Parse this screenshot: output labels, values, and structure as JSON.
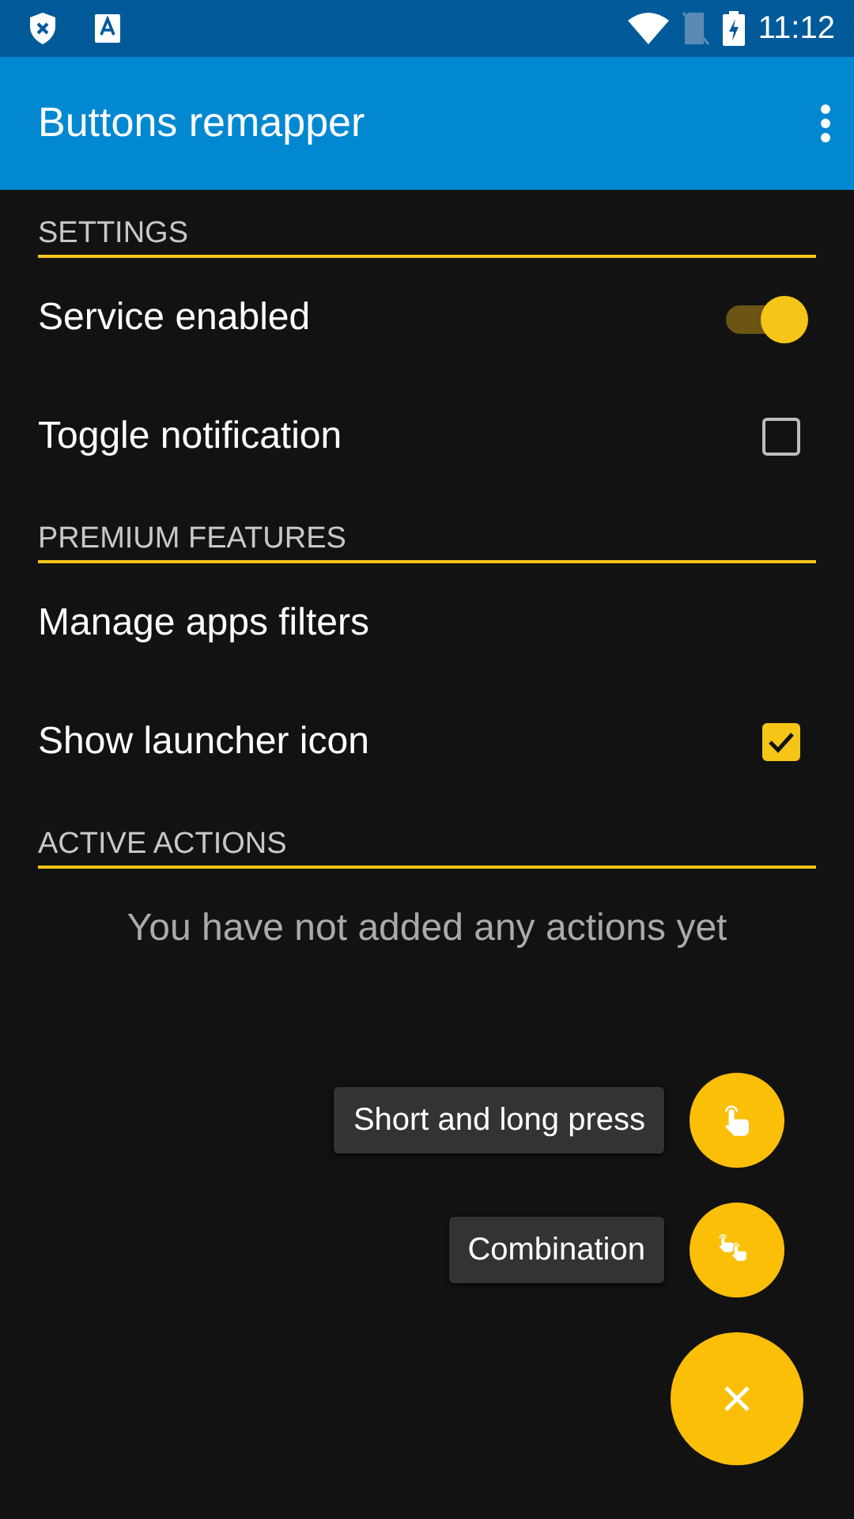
{
  "status_bar": {
    "time": "11:12"
  },
  "app_bar": {
    "title": "Buttons remapper"
  },
  "sections": [
    {
      "header": "SETTINGS",
      "items": [
        {
          "kind": "switch",
          "label": "Service enabled",
          "on": true
        },
        {
          "kind": "checkbox",
          "label": "Toggle notification",
          "checked": false
        }
      ]
    },
    {
      "header": "PREMIUM FEATURES",
      "items": [
        {
          "kind": "plain",
          "label": "Manage apps filters"
        },
        {
          "kind": "checkbox",
          "label": "Show launcher icon",
          "checked": true
        }
      ]
    },
    {
      "header": "ACTIVE ACTIONS"
    }
  ],
  "empty_message": "You have not added any actions yet",
  "fab_menu": {
    "expanded": true,
    "items": [
      {
        "kind": "single",
        "label": "Short and long press"
      },
      {
        "kind": "double",
        "label": "Combination"
      }
    ]
  }
}
